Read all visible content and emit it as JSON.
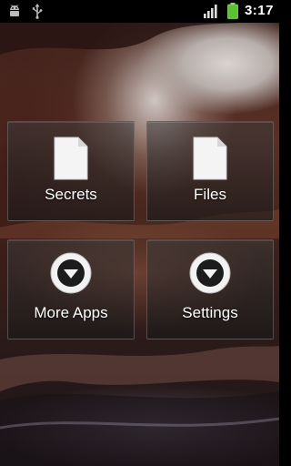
{
  "status_bar": {
    "time": "3:17",
    "icons": [
      "android-debug-icon",
      "usb-icon",
      "signal-icon",
      "battery-icon"
    ],
    "battery_color": "#5bc236"
  },
  "tiles": [
    {
      "label": "Secrets",
      "icon": "document-icon"
    },
    {
      "label": "Files",
      "icon": "document-icon"
    },
    {
      "label": "More Apps",
      "icon": "circle-down-arrow-icon"
    },
    {
      "label": "Settings",
      "icon": "circle-down-arrow-icon"
    }
  ]
}
